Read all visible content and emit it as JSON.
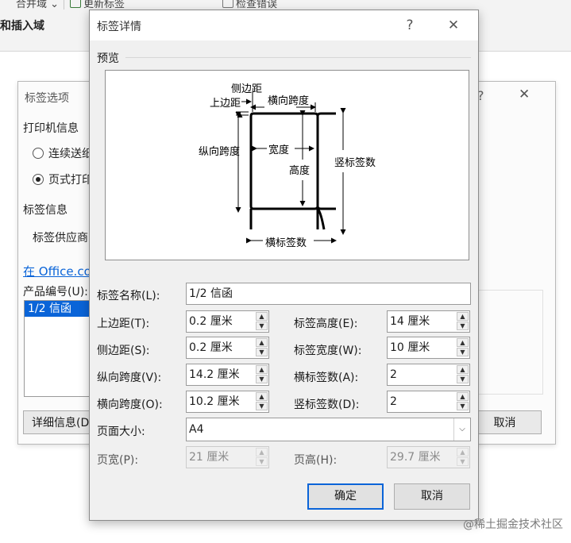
{
  "ribbon": {
    "merge_fields": "合并域",
    "update_labels": "更新标签",
    "check_errors": "检查错误",
    "group_label": "和插入域"
  },
  "options_dialog": {
    "title": "标签选项",
    "help": "?",
    "close": "✕",
    "printer_info": "打印机信息",
    "continuous_feed": "连续送纸",
    "page_printer": "页式打印",
    "label_info": "标签信息",
    "label_vendor": "标签供应商",
    "office_link": "在 Office.co",
    "product_number": "产品编号(U):",
    "products": [
      "1/2 信函"
    ],
    "details_button": "详细信息(D)",
    "cancel_button": "取消"
  },
  "details_dialog": {
    "title": "标签详情",
    "help": "?",
    "close": "✕",
    "preview_label": "预览",
    "preview": {
      "side_margin": "侧边距",
      "top_margin": "上边距",
      "horizontal_pitch": "横向跨度",
      "vertical_pitch": "纵向跨度",
      "width": "宽度",
      "height": "高度",
      "number_down": "竖标签数",
      "number_across": "横标签数"
    },
    "fields": {
      "label_name": {
        "label": "标签名称(L):",
        "value": "1/2 信函"
      },
      "top_margin": {
        "label": "上边距(T):",
        "value": "0.2 厘米"
      },
      "side_margin": {
        "label": "侧边距(S):",
        "value": "0.2 厘米"
      },
      "vertical_pitch": {
        "label": "纵向跨度(V):",
        "value": "14.2 厘米"
      },
      "horizontal_pitch": {
        "label": "横向跨度(O):",
        "value": "10.2 厘米"
      },
      "label_height": {
        "label": "标签高度(E):",
        "value": "14 厘米"
      },
      "label_width": {
        "label": "标签宽度(W):",
        "value": "10 厘米"
      },
      "number_across": {
        "label": "横标签数(A):",
        "value": "2"
      },
      "number_down": {
        "label": "竖标签数(D):",
        "value": "2"
      },
      "page_size": {
        "label": "页面大小:",
        "value": "A4"
      },
      "page_width": {
        "label": "页宽(P):",
        "value": "21 厘米"
      },
      "page_height": {
        "label": "页高(H):",
        "value": "29.7 厘米"
      }
    },
    "ok_button": "确定",
    "cancel_button": "取消"
  },
  "watermark": "@稀土掘金技术社区",
  "colors": {
    "accent": "#0a64d8",
    "dialog_bg": "#f0f0f0"
  }
}
